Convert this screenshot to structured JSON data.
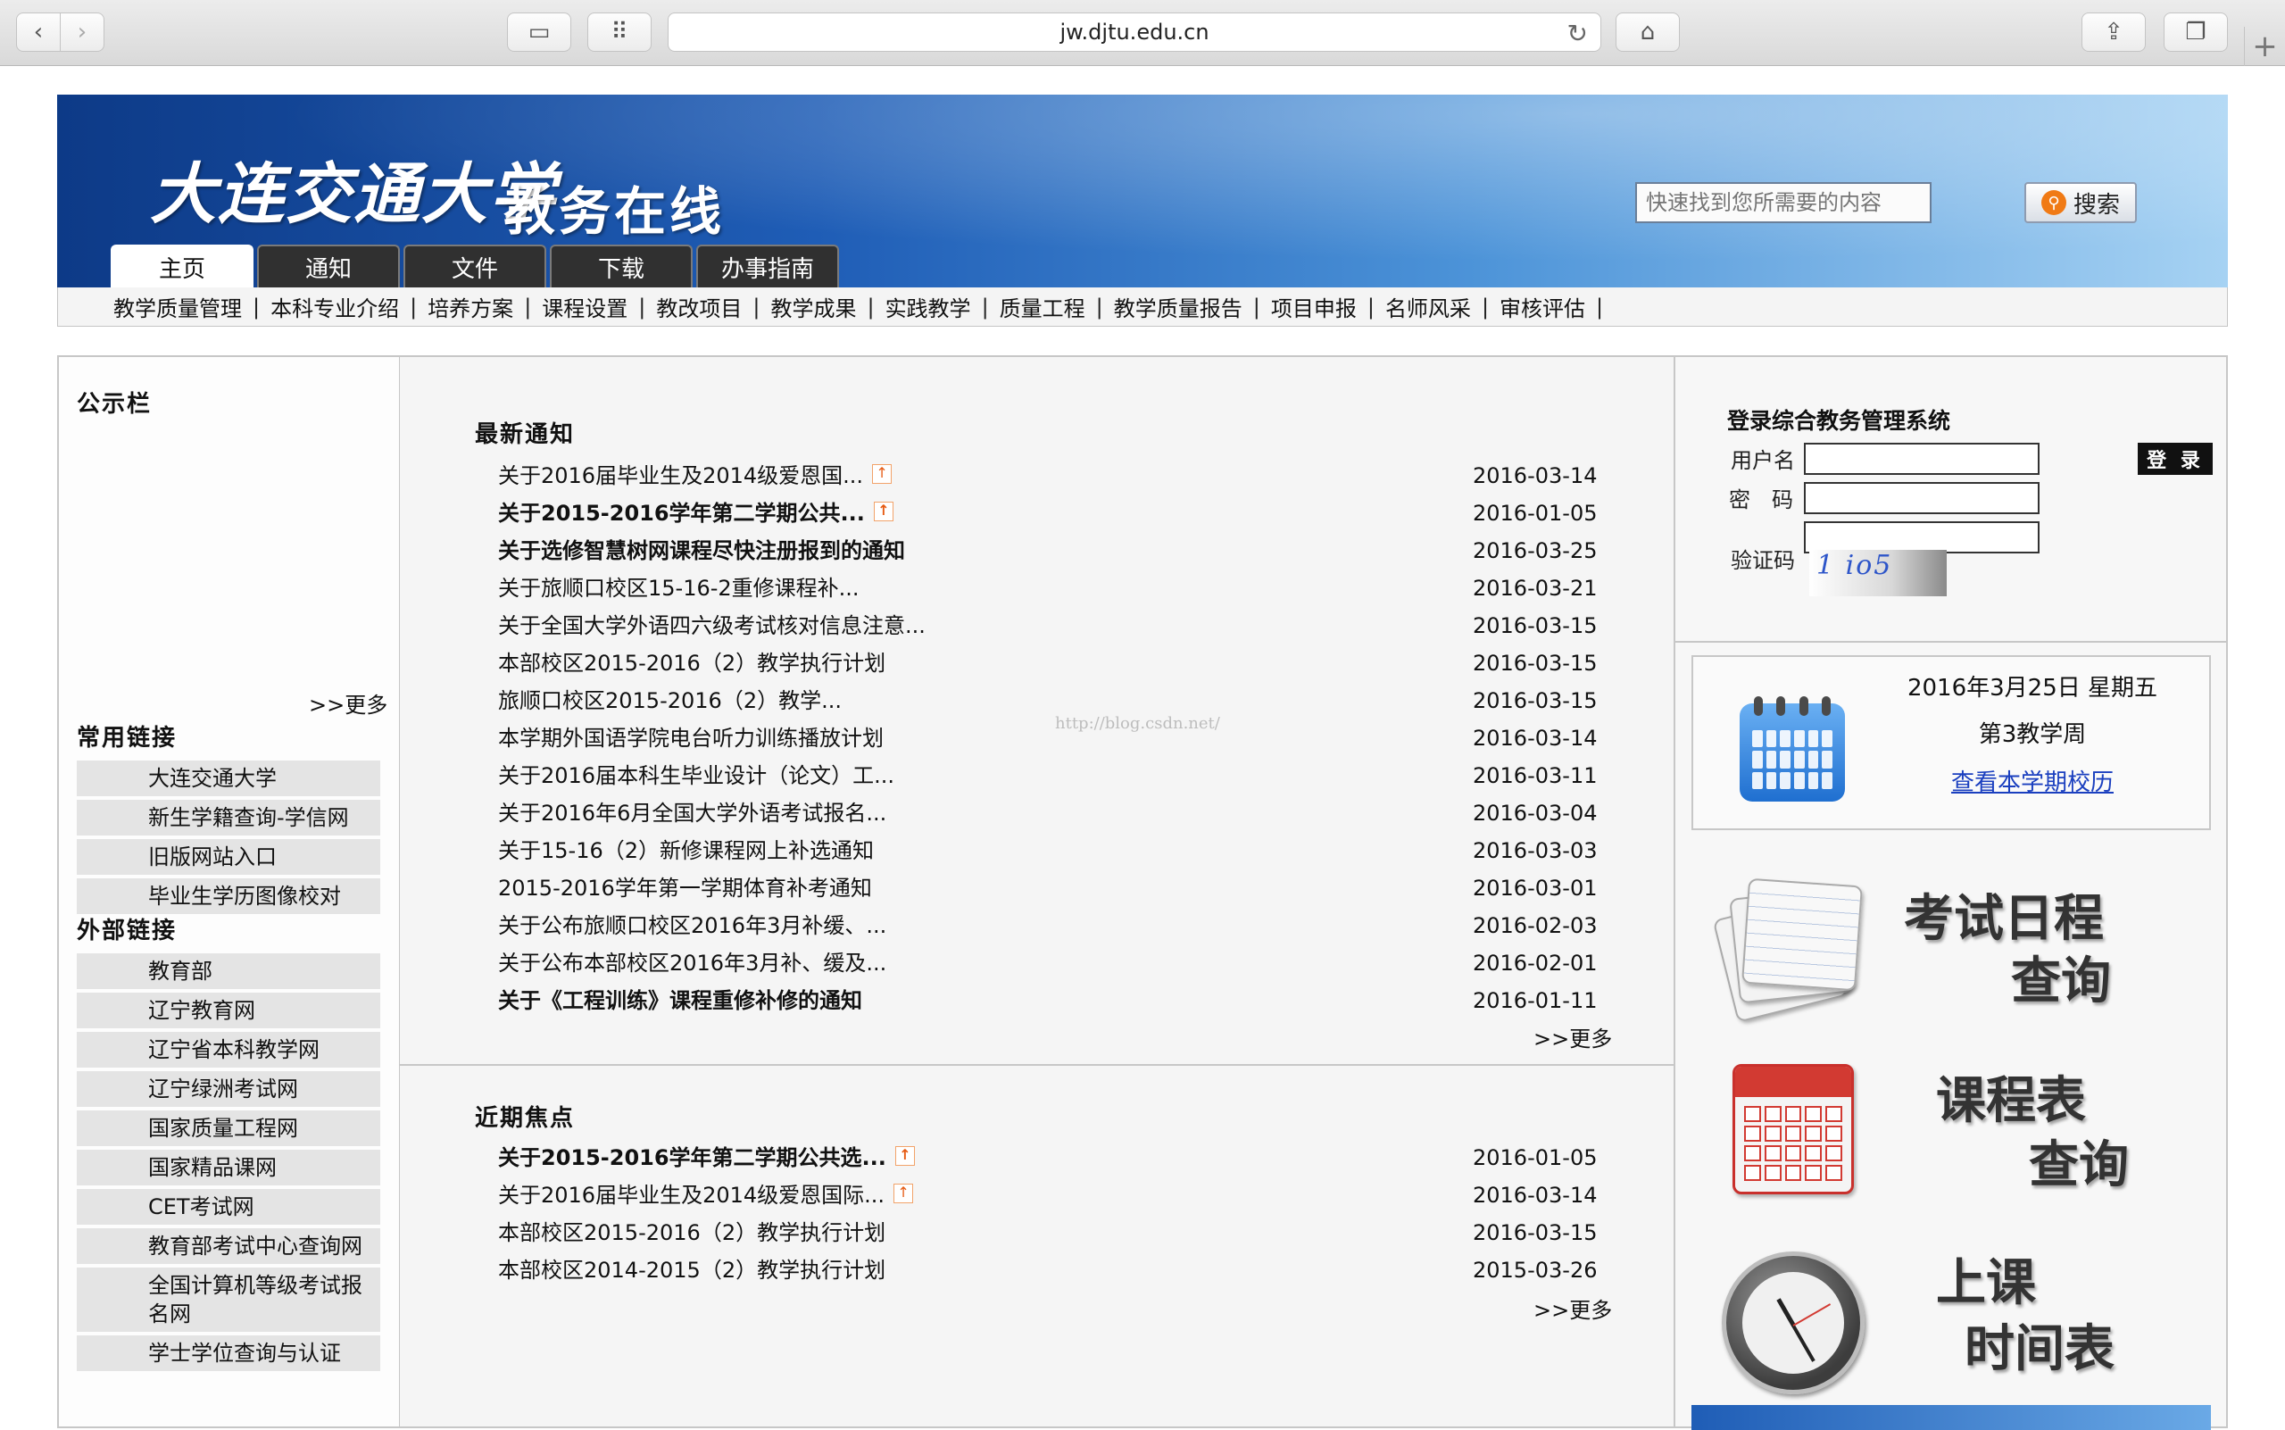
{
  "browser": {
    "url": "jw.djtu.edu.cn",
    "back_glyph": "‹",
    "forward_glyph": "›",
    "reload_glyph": "↻",
    "home_glyph": "⌂",
    "share_glyph": "⇪",
    "tabs_glyph": "❐",
    "newtab_glyph": "+",
    "sidebar_glyph": "▭",
    "grid_glyph": "⠿"
  },
  "header": {
    "university": "大连交通大学",
    "system": "教务在线",
    "search_placeholder": "快速找到您所需要的内容",
    "search_button": "搜索",
    "tabs": [
      {
        "label": "主页"
      },
      {
        "label": "通知"
      },
      {
        "label": "文件"
      },
      {
        "label": "下载"
      },
      {
        "label": "办事指南"
      }
    ],
    "subnav": [
      {
        "label": "教学质量管理"
      },
      {
        "label": "本科专业介绍"
      },
      {
        "label": "培养方案"
      },
      {
        "label": "课程设置"
      },
      {
        "label": "教改项目"
      },
      {
        "label": "教学成果"
      },
      {
        "label": "实践教学"
      },
      {
        "label": "质量工程"
      },
      {
        "label": "教学质量报告"
      },
      {
        "label": "项目申报"
      },
      {
        "label": "名师风采"
      },
      {
        "label": "审核评估"
      }
    ],
    "separator": "|"
  },
  "left": {
    "bulletin_title": "公示栏",
    "bulletin_more": ">>更多",
    "common_links_title": "常用链接",
    "common_links": [
      {
        "label": "大连交通大学"
      },
      {
        "label": "新生学籍查询-学信网"
      },
      {
        "label": "旧版网站入口"
      },
      {
        "label": "毕业生学历图像校对"
      }
    ],
    "external_links_title": "外部链接",
    "external_links": [
      {
        "label": "教育部"
      },
      {
        "label": "辽宁教育网"
      },
      {
        "label": "辽宁省本科教学网"
      },
      {
        "label": "辽宁绿洲考试网"
      },
      {
        "label": "国家质量工程网"
      },
      {
        "label": "国家精品课网"
      },
      {
        "label": "CET考试网"
      },
      {
        "label": "教育部考试中心查询网"
      },
      {
        "label": "全国计算机等级考试报名网"
      },
      {
        "label": "学士学位查询与认证"
      }
    ]
  },
  "center": {
    "latest_title": "最新通知",
    "latest_more": ">>更多",
    "latest": [
      {
        "title": "关于2016届毕业生及2014级爱恩国...",
        "date": "2016-03-14",
        "new_badge": "↑"
      },
      {
        "title": "关于2015-2016学年第二学期公共...",
        "date": "2016-01-05",
        "new_badge": "↑"
      },
      {
        "title": "关于选修智慧树网课程尽快注册报到的通知",
        "date": "2016-03-25"
      },
      {
        "title": "关于旅顺口校区15-16-2重修课程补...",
        "date": "2016-03-21"
      },
      {
        "title": "关于全国大学外语四六级考试核对信息注意...",
        "date": "2016-03-15"
      },
      {
        "title": "本部校区2015-2016（2）教学执行计划",
        "date": "2016-03-15"
      },
      {
        "title": "旅顺口校区2015-2016（2）教学...",
        "date": "2016-03-15"
      },
      {
        "title": "本学期外国语学院电台听力训练播放计划",
        "date": "2016-03-14"
      },
      {
        "title": "关于2016届本科生毕业设计（论文）工...",
        "date": "2016-03-11"
      },
      {
        "title": "关于2016年6月全国大学外语考试报名...",
        "date": "2016-03-04"
      },
      {
        "title": "关于15-16（2）新修课程网上补选通知",
        "date": "2016-03-03"
      },
      {
        "title": "2015-2016学年第一学期体育补考通知",
        "date": "2016-03-01"
      },
      {
        "title": "关于公布旅顺口校区2016年3月补缓、...",
        "date": "2016-02-03"
      },
      {
        "title": "关于公布本部校区2016年3月补、缓及...",
        "date": "2016-02-01"
      },
      {
        "title": "关于《工程训练》课程重修补修的通知",
        "date": "2016-01-11"
      }
    ],
    "watermark": "http://blog.csdn.net/",
    "focus_title": "近期焦点",
    "focus_more": ">>更多",
    "focus": [
      {
        "title": "关于2015-2016学年第二学期公共选...",
        "date": "2016-01-05",
        "new_badge": "↑"
      },
      {
        "title": "关于2016届毕业生及2014级爱恩国际...",
        "date": "2016-03-14",
        "new_badge": "↑"
      },
      {
        "title": "本部校区2015-2016（2）教学执行计划",
        "date": "2016-03-15"
      },
      {
        "title": "本部校区2014-2015（2）教学执行计划",
        "date": "2015-03-26"
      }
    ]
  },
  "right": {
    "login_title": "登录综合教务管理系统",
    "username_label": "用户名",
    "password_label": "密　码",
    "captcha_label": "验证码",
    "captcha_text": "1 io5",
    "login_button": "登 录",
    "calendar_date": "2016年3月25日 星期五",
    "calendar_week": "第3教学周",
    "calendar_link": "查看本学期校历",
    "exam_text_1": "考试日程",
    "exam_text_2": "查询",
    "schedule_text_1": "课程表",
    "schedule_text_2": "查询",
    "classtime_text_1": "上课",
    "classtime_text_2": "时间表"
  }
}
